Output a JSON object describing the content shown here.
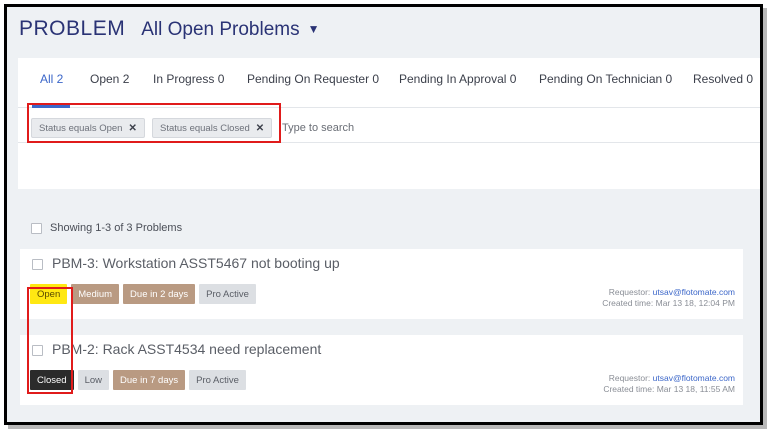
{
  "header": {
    "module": "PROBLEM",
    "view": "All Open Problems"
  },
  "tabs": [
    {
      "label": "All 2",
      "active": true
    },
    {
      "label": "Open 2"
    },
    {
      "label": "In Progress 0"
    },
    {
      "label": "Pending On Requester 0"
    },
    {
      "label": "Pending In Approval 0"
    },
    {
      "label": "Pending On Technician 0"
    },
    {
      "label": "Resolved 0"
    }
  ],
  "filters": {
    "chips": [
      "Status equals Open",
      "Status equals Closed"
    ],
    "placeholder": "Type to search"
  },
  "summary": "Showing 1-3 of 3 Problems",
  "labels": {
    "requestor": "Requestor:",
    "created": "Created time:"
  },
  "colors": {
    "accent": "#3c67c9",
    "title": "#2a3375",
    "highlight": "#e01b1b"
  },
  "problems": [
    {
      "title": "PBM-3: Workstation ASST5467 not booting up",
      "status": "Open",
      "priority": "Medium",
      "due": "Due in 2 days",
      "type": "Pro Active",
      "requestor": "utsav@flotomate.com",
      "created_time": "Mar 13 18, 12:04 PM"
    },
    {
      "title": "PBM-2: Rack ASST4534 need replacement",
      "status": "Closed",
      "priority": "Low",
      "due": "Due in 7 days",
      "type": "Pro Active",
      "requestor": "utsav@flotomate.com",
      "created_time": "Mar 13 18, 11:55 AM"
    }
  ]
}
